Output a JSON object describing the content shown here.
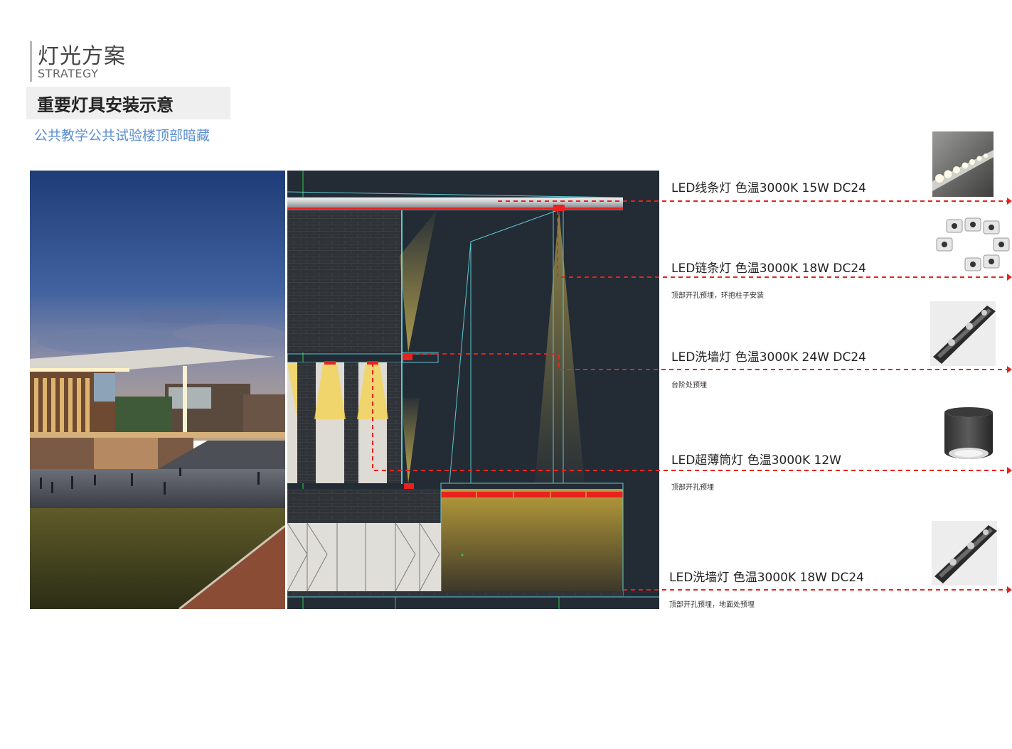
{
  "header": {
    "title": "灯光方案",
    "subtitle": "STRATEGY",
    "section_title": "重要灯具安装示意",
    "caption": "公共教学公共试验楼顶部暗藏"
  },
  "colors": {
    "cad_background": "#232b35",
    "leader_line": "#e8221f",
    "light_glow": "#f0d05a",
    "caption_blue": "#5b8fd0"
  },
  "fixtures": [
    {
      "name": "LED线条灯 色温3000K 15W DC24",
      "note": "",
      "icon": "linear-strip-light-icon"
    },
    {
      "name": "LED链条灯 色温3000K 18W DC24",
      "note": "顶部开孔预埋，环抱柱子安装",
      "icon": "chain-light-icon"
    },
    {
      "name": "LED洗墙灯 色温3000K 24W DC24",
      "note": "台阶处预埋",
      "icon": "wall-washer-icon"
    },
    {
      "name": "LED超薄筒灯 色温3000K 12W",
      "note": "顶部开孔预埋",
      "icon": "downlight-icon"
    },
    {
      "name": "LED洗墙灯 色温3000K 18W DC24",
      "note": "顶部开孔预埋，地面处预埋",
      "icon": "wall-washer-icon"
    }
  ]
}
